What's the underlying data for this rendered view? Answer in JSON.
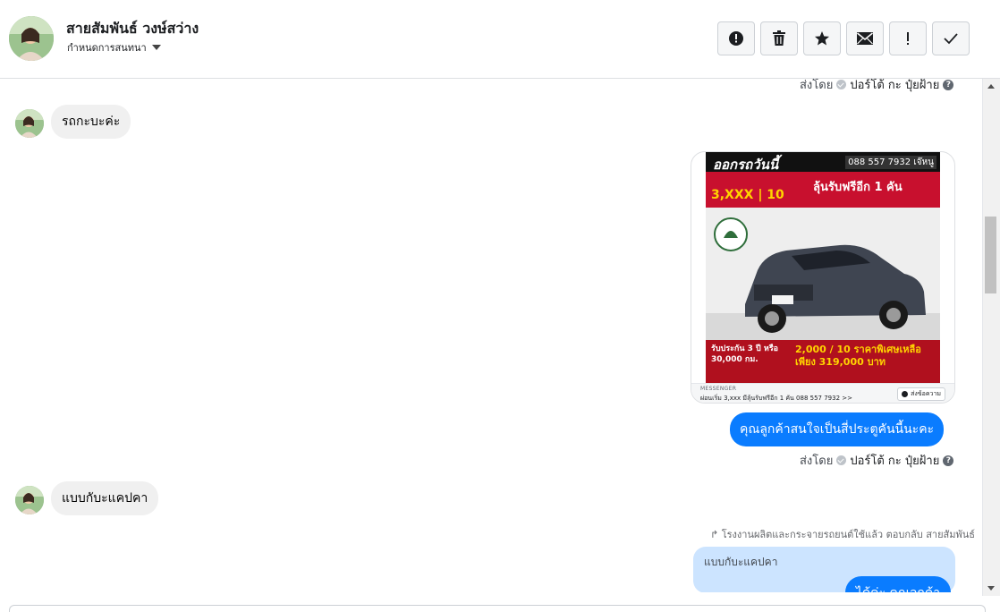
{
  "header": {
    "contact_name": "สายสัมพันธ์ วงษ์สว่าง",
    "assign_label": "กำหนดการสนทนา",
    "toolbar": [
      {
        "name": "report-spam-button",
        "icon": "alert-circle-icon"
      },
      {
        "name": "delete-button",
        "icon": "trash-icon"
      },
      {
        "name": "star-button",
        "icon": "star-icon"
      },
      {
        "name": "mark-unread-button",
        "icon": "envelope-icon"
      },
      {
        "name": "follow-up-button",
        "icon": "exclamation-icon"
      },
      {
        "name": "mark-done-button",
        "icon": "check-icon"
      }
    ]
  },
  "messages": {
    "top_sentby": {
      "prefix": "ส่งโดย",
      "name": "ปอร์โต้ กะ ปุ๋ยฝ้าย"
    },
    "incoming_1": "รถกะบะค่ะ",
    "ad": {
      "headline": "ออกรถวันนี้",
      "phone": "088 557 7932 เจ๊หนู",
      "promo": "ลุ้นรับฟรีอีก 1 คัน",
      "price_start": "3,XXX | 10",
      "bottom_left": "รับประกัน 3 ปี หรือ 30,000 กม.",
      "bottom_right": "2,000 / 10 ราคาพิเศษเหลือเพียง 319,000 บาท",
      "source": "MESSENGER",
      "caption": "ผ่อนเริ่ม 3,xxx มีลุ้นรับฟรีอีก 1 คัน 088 557 7932 >>",
      "send_label": "ส่งข้อความ"
    },
    "outgoing_1": "คุณลูกค้าสนใจเป็นสี่ประตูคันนี้นะคะ",
    "sentby_2": {
      "prefix": "ส่งโดย",
      "name": "ปอร์โต้ กะ ปุ๋ยฝ้าย"
    },
    "incoming_2": "แบบกับะแคปคา",
    "reply_note": "โรงงานผลิตและกระจายรถยนต์ใช้แล้ว ตอบกลับ สายสัมพันธ์",
    "reply_quote": "แบบกับะแคปคา",
    "outgoing_2": "ได้ค่ะ คุณลูกค้า"
  },
  "colors": {
    "accent": "#0a7cff",
    "incoming_bubble": "#f0f0f0",
    "reply_quote_bg": "#cce4ff"
  }
}
